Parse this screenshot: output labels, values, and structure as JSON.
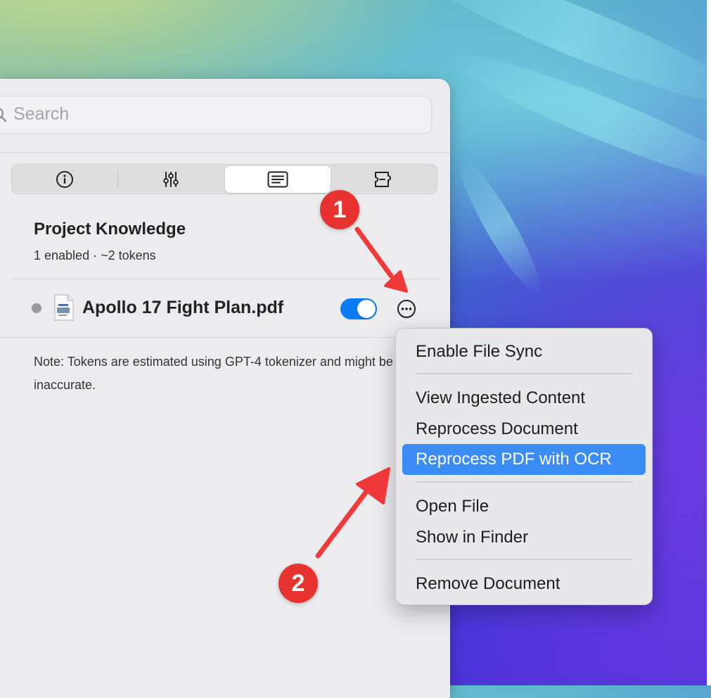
{
  "search": {
    "placeholder": "Search",
    "value": ""
  },
  "tabs": [
    {
      "icon": "info-icon",
      "selected": false
    },
    {
      "icon": "sliders-icon",
      "selected": false
    },
    {
      "icon": "document-list-icon",
      "selected": true
    },
    {
      "icon": "plugin-icon",
      "selected": false
    }
  ],
  "section": {
    "title": "Project Knowledge",
    "subtitle": "1 enabled · ~2 tokens"
  },
  "document": {
    "name": "Apollo 17 Fight Plan.pdf",
    "enabled": true,
    "status_color": "#9a9a9e"
  },
  "note": "Note: Tokens are estimated using GPT-4 tokenizer and might be inaccurate.",
  "context_menu": {
    "groups": [
      [
        "Enable File Sync"
      ],
      [
        "View Ingested Content",
        "Reprocess Document",
        "Reprocess PDF with OCR"
      ],
      [
        "Open File",
        "Show in Finder"
      ],
      [
        "Remove Document"
      ]
    ],
    "highlighted": "Reprocess PDF with OCR"
  },
  "annotations": [
    {
      "label": "1",
      "color": "#e8322f"
    },
    {
      "label": "2",
      "color": "#e8322f"
    }
  ],
  "colors": {
    "accent": "#0a7cf8",
    "menu_highlight": "#3b8cf5",
    "annotation": "#e8322f"
  }
}
